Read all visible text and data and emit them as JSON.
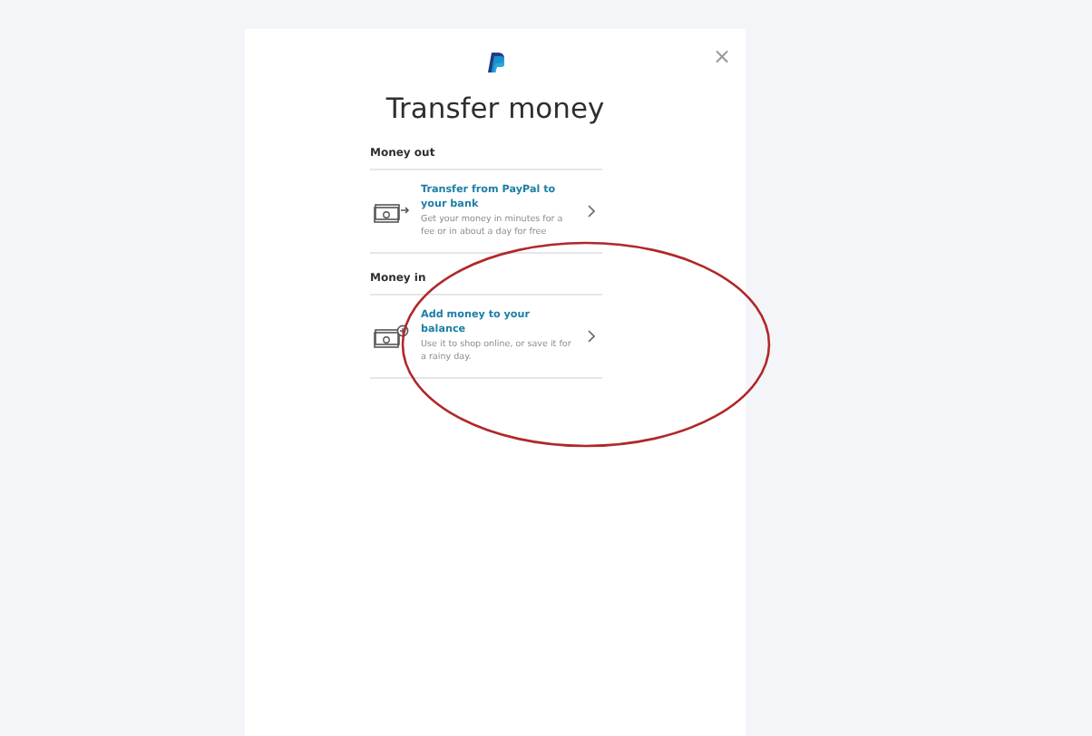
{
  "dialog": {
    "title": "Transfer money",
    "close": "×"
  },
  "sections": [
    {
      "heading": "Money out",
      "items": [
        {
          "kind": "send",
          "title": "Transfer from PayPal to your bank",
          "description": "Get your money in minutes for a fee or in about a day for free"
        }
      ]
    },
    {
      "heading": "Money in",
      "items": [
        {
          "kind": "add",
          "title": "Add money to your balance",
          "description": "Use it to shop online, or save it for a rainy day."
        }
      ]
    }
  ]
}
